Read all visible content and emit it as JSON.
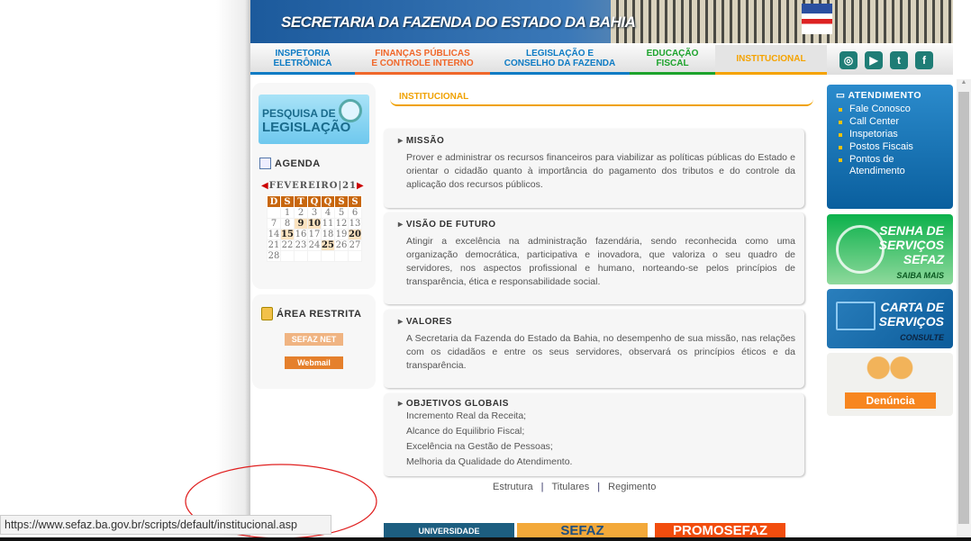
{
  "header": {
    "title": "SECRETARIA DA FAZENDA DO ESTADO DA BAHIA"
  },
  "nav": [
    {
      "label": "INSPETORIA ELETRÔNICA",
      "color": "#0d7bc4"
    },
    {
      "label": "FINANÇAS PÚBLICAS E CONTROLE INTERNO",
      "color": "#f0672a"
    },
    {
      "label": "LEGISLAÇÃO E CONSELHO DA FAZENDA",
      "color": "#0d7bc4"
    },
    {
      "label": "EDUCAÇÃO FISCAL",
      "color": "#1ca32c"
    },
    {
      "label": "INSTITUCIONAL",
      "color": "#f5a300"
    }
  ],
  "social": [
    "instagram-icon",
    "youtube-icon",
    "twitter-icon",
    "facebook-icon"
  ],
  "left": {
    "pesquisa": [
      "PESQUISA DE",
      "LEGISLAÇÃO"
    ],
    "agenda": {
      "title": "AGENDA",
      "month": "FEVEREIRO|21",
      "days": [
        "D",
        "S",
        "T",
        "Q",
        "Q",
        "S",
        "S"
      ],
      "weeks": [
        [
          "",
          "1",
          "2",
          "3",
          "4",
          "5",
          "6"
        ],
        [
          "7",
          "8",
          "9",
          "10",
          "11",
          "12",
          "13"
        ],
        [
          "14",
          "15",
          "16",
          "17",
          "18",
          "19",
          "20"
        ],
        [
          "21",
          "22",
          "23",
          "24",
          "25",
          "26",
          "27"
        ],
        [
          "28",
          "",
          "",
          "",
          "",
          "",
          ""
        ]
      ],
      "highlighted": [
        "9",
        "10",
        "15",
        "20",
        "25"
      ]
    },
    "restrita": {
      "title": "ÁREA RESTRITA",
      "sefaznet": "SEFAZ NET",
      "webmail": "Webmail"
    }
  },
  "main": {
    "title": "INSTITUCIONAL",
    "missao": {
      "title": "MISSÃO",
      "text": "Prover e administrar os recursos financeiros para viabilizar as políticas públicas do Estado e orientar o cidadão quanto à importância do pagamento dos tributos e do controle da aplicação dos recursos públicos."
    },
    "visao": {
      "title": "VISÃO DE FUTURO",
      "text": "Atingir a excelência na administração fazendária, sendo reconhecida como uma organização democrática, participativa e inovadora, que valoriza o seu quadro de servidores, nos aspectos profissional e humano, norteando-se pelos princípios de transparência, ética e responsabilidade social."
    },
    "valores": {
      "title": "VALORES",
      "text": "A Secretaria da Fazenda do Estado da Bahia, no desempenho de sua missão, nas relações com os cidadãos e entre os seus servidores, observará os princípios éticos e da transparência."
    },
    "objetivos": {
      "title": "OBJETIVOS GLOBAIS",
      "items": [
        "Incremento Real da Receita;",
        "Alcance do Equilibrio Fiscal;",
        "Excelência na Gestão de Pessoas;",
        "Melhoria da Qualidade do Atendimento."
      ]
    },
    "links": [
      "Estrutura",
      "Titulares",
      "Regimento"
    ],
    "banners": [
      "UNIVERSIDADE",
      "SEFAZ",
      "PROMOSEFAZ"
    ]
  },
  "right": {
    "atendimento": {
      "title": "ATENDIMENTO",
      "items": [
        "Fale Conosco",
        "Call Center",
        "Inspetorias",
        "Postos Fiscais",
        "Pontos de Atendimento"
      ]
    },
    "senha": {
      "lines": [
        "SENHA DE",
        "SERVIÇOS",
        "SEFAZ"
      ],
      "cta": "SAIBA MAIS"
    },
    "carta": {
      "lines": [
        "CARTA DE",
        "SERVIÇOS"
      ],
      "cta": "CONSULTE"
    },
    "denuncia": "Denúncia"
  },
  "statusbar": "https://www.sefaz.ba.gov.br/scripts/default/institucional.asp"
}
